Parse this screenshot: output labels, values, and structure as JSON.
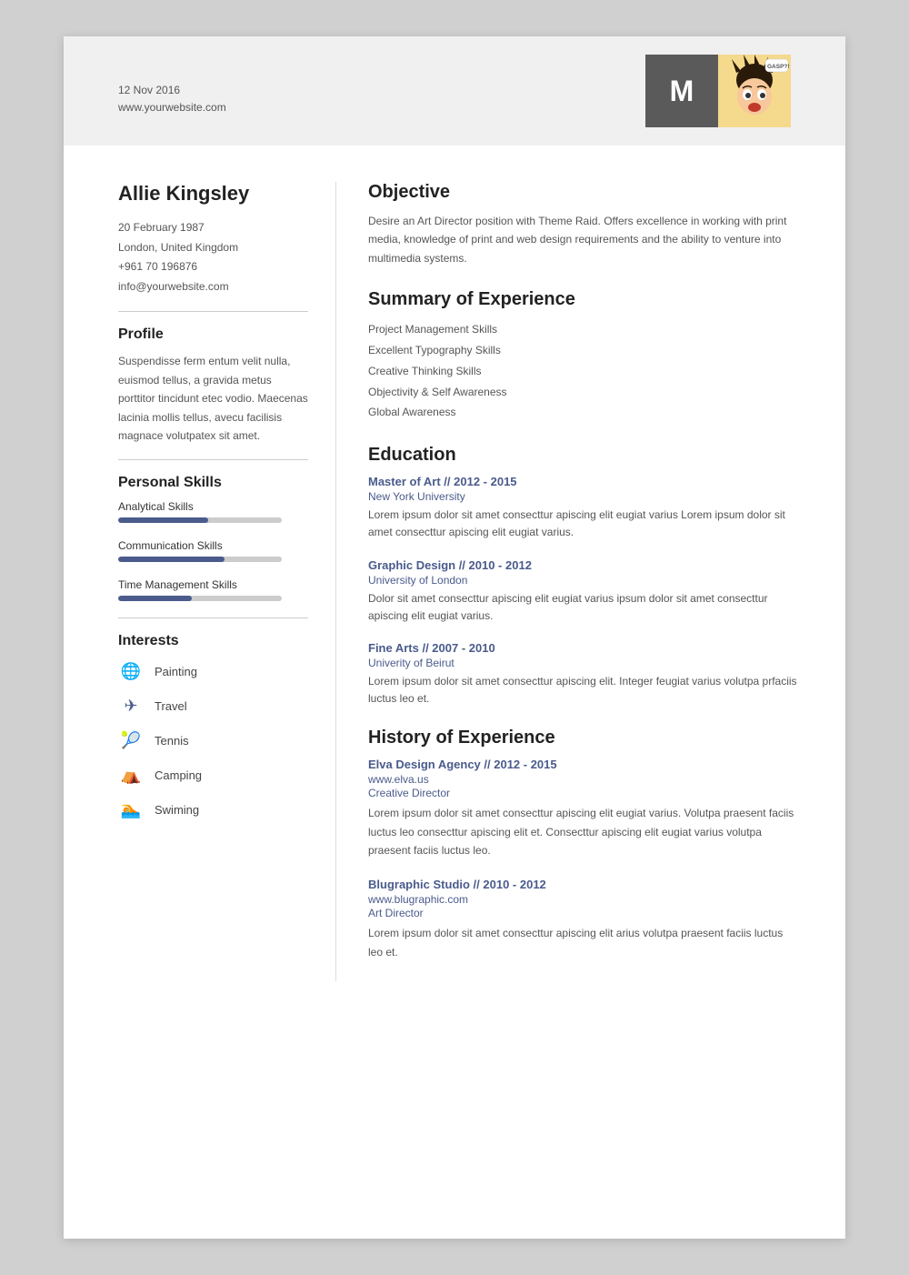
{
  "header": {
    "date": "12 Nov 2016",
    "website": "www.yourwebsite.com",
    "initial": "M"
  },
  "person": {
    "name": "Allie Kingsley",
    "dob": "20 February 1987",
    "location": "London, United Kingdom",
    "phone": "+961 70 196876",
    "email": "info@yourwebsite.com"
  },
  "profile": {
    "title": "Profile",
    "text": "Suspendisse ferm entum velit nulla, euismod tellus, a gravida metus porttitor tincidunt etec vodio. Maecenas lacinia mollis tellus, avecu facilisis magnace volutpatex sit amet."
  },
  "personal_skills": {
    "title": "Personal Skills",
    "skills": [
      {
        "label": "Analytical Skills",
        "percent": 55
      },
      {
        "label": "Communication Skills",
        "percent": 65
      },
      {
        "label": "Time Management Skills",
        "percent": 45
      }
    ]
  },
  "interests": {
    "title": "Interests",
    "items": [
      {
        "icon": "🌐",
        "label": "Painting"
      },
      {
        "icon": "✈",
        "label": "Travel"
      },
      {
        "icon": "🎾",
        "label": "Tennis"
      },
      {
        "icon": "⛺",
        "label": "Camping"
      },
      {
        "icon": "🏊",
        "label": "Swiming"
      }
    ]
  },
  "objective": {
    "title": "Objective",
    "text": "Desire an Art Director position with Theme Raid. Offers excellence in working with print media, knowledge of print and web design requirements and the ability to venture into multimedia systems."
  },
  "summary": {
    "title": "Summary of Experience",
    "items": [
      "Project Management Skills",
      "Excellent Typography Skills",
      "Creative Thinking Skills",
      "Objectivity & Self Awareness",
      "Global Awareness"
    ]
  },
  "education": {
    "title": "Education",
    "entries": [
      {
        "degree": "Master of Art // 2012 - 2015",
        "institution": "New York University",
        "description": "Lorem ipsum dolor sit amet consecttur apiscing elit eugiat varius Lorem ipsum dolor sit amet consecttur apiscing elit eugiat varius."
      },
      {
        "degree": "Graphic Design // 2010 - 2012",
        "institution": "University of London",
        "description": "Dolor sit amet consecttur apiscing elit eugiat varius  ipsum dolor sit amet consecttur apiscing elit eugiat varius."
      },
      {
        "degree": "Fine Arts // 2007 - 2010",
        "institution": "Univerity of Beirut",
        "description": "Lorem ipsum dolor sit amet consecttur apiscing elit. Integer feugiat varius volutpa prfaciis luctus leo et."
      }
    ]
  },
  "history": {
    "title": "History of Experience",
    "entries": [
      {
        "company": "Elva Design Agency // 2012 - 2015",
        "url": "www.elva.us",
        "role": "Creative Director",
        "description": "Lorem ipsum dolor sit amet consecttur apiscing elit eugiat varius.\nVolutpa praesent faciis luctus leo consecttur apiscing elit et.\nConsecttur apiscing elit eugiat varius volutpa praesent faciis luctus leo."
      },
      {
        "company": "Blugraphic Studio // 2010 - 2012",
        "url": "www.blugraphic.com",
        "role": "Art Director",
        "description": "Lorem ipsum dolor sit amet consecttur apiscing elit arius volutpa praesent faciis luctus leo et."
      }
    ]
  }
}
